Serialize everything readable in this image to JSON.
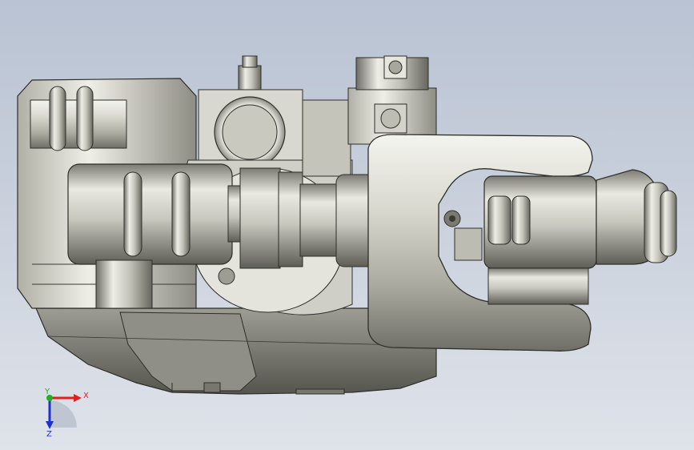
{
  "viewport": {
    "background_top": "#b9c3d3",
    "background_bottom": "#dfe3ea",
    "model": "cad-robot-wrist-assembly"
  },
  "triad": {
    "x_label": "X",
    "y_label": "Y",
    "z_label": "Z",
    "x_color": "#e02020",
    "y_color": "#20b020",
    "z_color": "#2030d0"
  }
}
